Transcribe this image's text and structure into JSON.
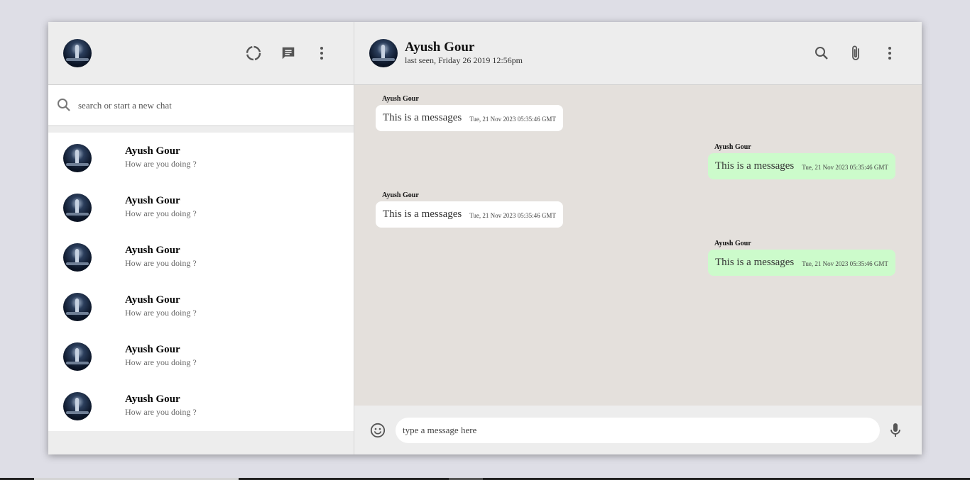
{
  "sidebar": {
    "search": {
      "placeholder": "search or start a new chat"
    },
    "chats": [
      {
        "name": "Ayush Gour",
        "preview": "How are you doing ?"
      },
      {
        "name": "Ayush Gour",
        "preview": "How are you doing ?"
      },
      {
        "name": "Ayush Gour",
        "preview": "How are you doing ?"
      },
      {
        "name": "Ayush Gour",
        "preview": "How are you doing ?"
      },
      {
        "name": "Ayush Gour",
        "preview": "How are you doing ?"
      },
      {
        "name": "Ayush Gour",
        "preview": "How are you doing ?"
      }
    ]
  },
  "header": {
    "contact_name": "Ayush Gour",
    "contact_status": "last seen, Friday 26 2019 12:56pm"
  },
  "messages": [
    {
      "sender": "Ayush Gour",
      "text": "This is a messages",
      "time": "Tue, 21 Nov 2023 05:35:46 GMT",
      "direction": "in"
    },
    {
      "sender": "Ayush Gour",
      "text": "This is a messages",
      "time": "Tue, 21 Nov 2023 05:35:46 GMT",
      "direction": "out"
    },
    {
      "sender": "Ayush Gour",
      "text": "This is a messages",
      "time": "Tue, 21 Nov 2023 05:35:46 GMT",
      "direction": "in"
    },
    {
      "sender": "Ayush Gour",
      "text": "This is a messages",
      "time": "Tue, 21 Nov 2023 05:35:46 GMT",
      "direction": "out"
    }
  ],
  "composer": {
    "placeholder": "type a message here"
  },
  "colors": {
    "incoming_bubble": "#ffffff",
    "outgoing_bubble": "#ccfbcb",
    "chat_background": "#e4e0dc",
    "panel_background": "#ededed"
  },
  "icons": {
    "sidebar_header": [
      "avatar",
      "status-icon",
      "new-chat-icon",
      "menu-icon"
    ],
    "main_header": [
      "search-icon",
      "attach-icon",
      "menu-icon"
    ],
    "composer": [
      "emoji-icon",
      "mic-icon"
    ]
  }
}
